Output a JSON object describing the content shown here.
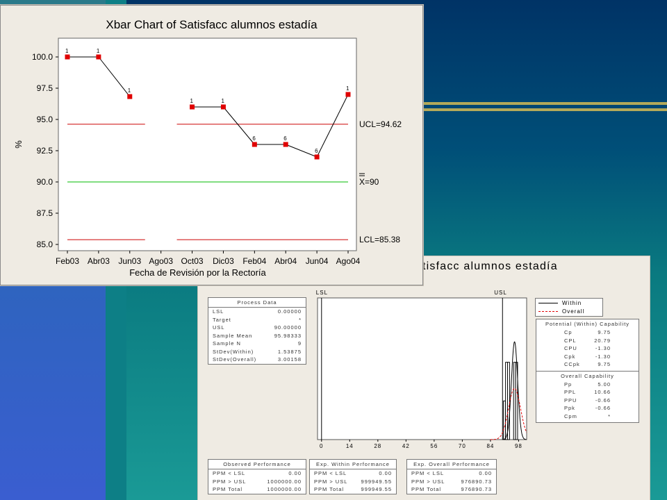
{
  "xbar": {
    "title": "Xbar Chart of Satisfacc alumnos estadía",
    "ylabel": "%",
    "xlabel": "Fecha de Revisión por la Rectoría",
    "ucl_label": "UCL=94.62",
    "center_label": "X=90",
    "lcl_label": "LCL=85.38"
  },
  "capability": {
    "title": "tisfacc alumnos estadía",
    "lsl_label": "LSL",
    "usl_label": "USL",
    "legend": {
      "within": "Within",
      "overall": "Overall"
    },
    "process_data": {
      "header": "Process Data",
      "rows": [
        {
          "k": "LSL",
          "v": "0.00000"
        },
        {
          "k": "Target",
          "v": "*"
        },
        {
          "k": "USL",
          "v": "90.00000"
        },
        {
          "k": "Sample Mean",
          "v": "95.98333"
        },
        {
          "k": "Sample N",
          "v": "9"
        },
        {
          "k": "StDev(Within)",
          "v": "1.53875"
        },
        {
          "k": "StDev(Overall)",
          "v": "3.00158"
        }
      ]
    },
    "potential": {
      "header": "Potential (Within) Capability",
      "rows": [
        {
          "k": "Cp",
          "v": "9.75"
        },
        {
          "k": "CPL",
          "v": "20.79"
        },
        {
          "k": "CPU",
          "v": "-1.30"
        },
        {
          "k": "Cpk",
          "v": "-1.30"
        },
        {
          "k": "CCpk",
          "v": "9.75"
        }
      ]
    },
    "overall": {
      "header": "Overall Capability",
      "rows": [
        {
          "k": "Pp",
          "v": "5.00"
        },
        {
          "k": "PPL",
          "v": "10.66"
        },
        {
          "k": "PPU",
          "v": "-0.66"
        },
        {
          "k": "Ppk",
          "v": "-0.66"
        },
        {
          "k": "Cpm",
          "v": "*"
        }
      ]
    },
    "observed": {
      "header": "Observed Performance",
      "rows": [
        {
          "k": "PPM < LSL",
          "v": "0.00"
        },
        {
          "k": "PPM > USL",
          "v": "1000000.00"
        },
        {
          "k": "PPM Total",
          "v": "1000000.00"
        }
      ]
    },
    "exp_within": {
      "header": "Exp. Within Performance",
      "rows": [
        {
          "k": "PPM < LSL",
          "v": "0.00"
        },
        {
          "k": "PPM > USL",
          "v": "999949.55"
        },
        {
          "k": "PPM Total",
          "v": "999949.55"
        }
      ]
    },
    "exp_overall": {
      "header": "Exp. Overall Performance",
      "rows": [
        {
          "k": "PPM < LSL",
          "v": "0.00"
        },
        {
          "k": "PPM > USL",
          "v": "976890.73"
        },
        {
          "k": "PPM Total",
          "v": "976890.73"
        }
      ]
    }
  },
  "colors": {
    "points": "#e00000",
    "limits": "#cc0000",
    "center": "#00bb00",
    "window": "#efebe3"
  },
  "chart_data": [
    {
      "type": "line",
      "title": "Xbar Chart of Satisfacc alumnos estadía",
      "xlabel": "Fecha de Revisión por la Rectoría",
      "ylabel": "%",
      "categories": [
        "Feb03",
        "Abr03",
        "Jun03",
        "Ago03",
        "Oct03",
        "Dic03",
        "Feb04",
        "Abr04",
        "Jun04",
        "Ago04"
      ],
      "series": [
        {
          "values": [
            100.0,
            100.0,
            96.83,
            null,
            96.0,
            96.0,
            93.0,
            93.0,
            92.0,
            97.0
          ]
        }
      ],
      "test_flags": [
        "1",
        "1",
        "1",
        "",
        "1",
        "1",
        "6",
        "6",
        "6",
        "1"
      ],
      "ucl": 94.62,
      "center": 90,
      "lcl": 85.38,
      "yticks": [
        "85.0",
        "87.5",
        "90.0",
        "92.5",
        "95.0",
        "97.5",
        "100.0"
      ],
      "ylim": [
        84.5,
        101.5
      ],
      "grid": false
    },
    {
      "type": "bar",
      "title": "tisfacc alumnos estadía",
      "xticks": [
        "0",
        "14",
        "28",
        "42",
        "56",
        "70",
        "84",
        "98"
      ],
      "xlim": [
        -2,
        102
      ],
      "lsl": 0,
      "usl": 90,
      "bins": [
        {
          "x": 91,
          "count": 1
        },
        {
          "x": 92,
          "count": 2
        },
        {
          "x": 93,
          "count": 2
        },
        {
          "x": 96,
          "count": 2
        },
        {
          "x": 97,
          "count": 2
        }
      ],
      "within_mean": 95.98333,
      "within_sd": 1.53875,
      "overall_mean": 95.98333,
      "overall_sd": 3.00158,
      "legend": "right"
    }
  ]
}
